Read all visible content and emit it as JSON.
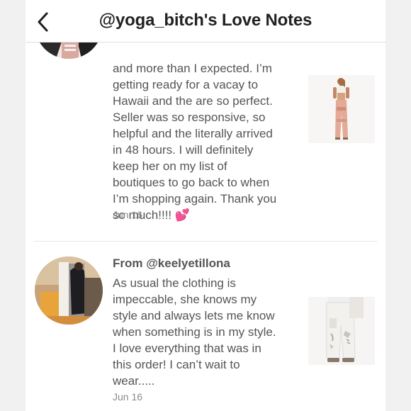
{
  "header": {
    "title": "@yoga_bitch's Love Notes",
    "back_icon": "chevron-left-icon"
  },
  "reviews": [
    {
      "body": "and more than I expected. I’m\ngetting ready for a vacay to\nHawaii and the are so perfect.\nSeller was so responsive, so\nhelpful and the literally arrived\nin 48 hours. I will definitely\nkeep her on my list of\nboutiques to go back to when\nI’m shopping again. Thank you\nso much!!!! 💕",
      "date": "Jun 16"
    },
    {
      "author": "From @keelyetillona",
      "body": "As usual the clothing is\nimpeccable, she knows my\nstyle and always lets me know\nwhen something is in my style.\nI love everything that was in\nthis order! I can’t wait to\nwear.....",
      "date": "Jun 16"
    }
  ],
  "colors": {
    "text": "#555555",
    "date": "#8a8a8a",
    "divider": "#e6e6e6",
    "heart": "#e0428a"
  }
}
